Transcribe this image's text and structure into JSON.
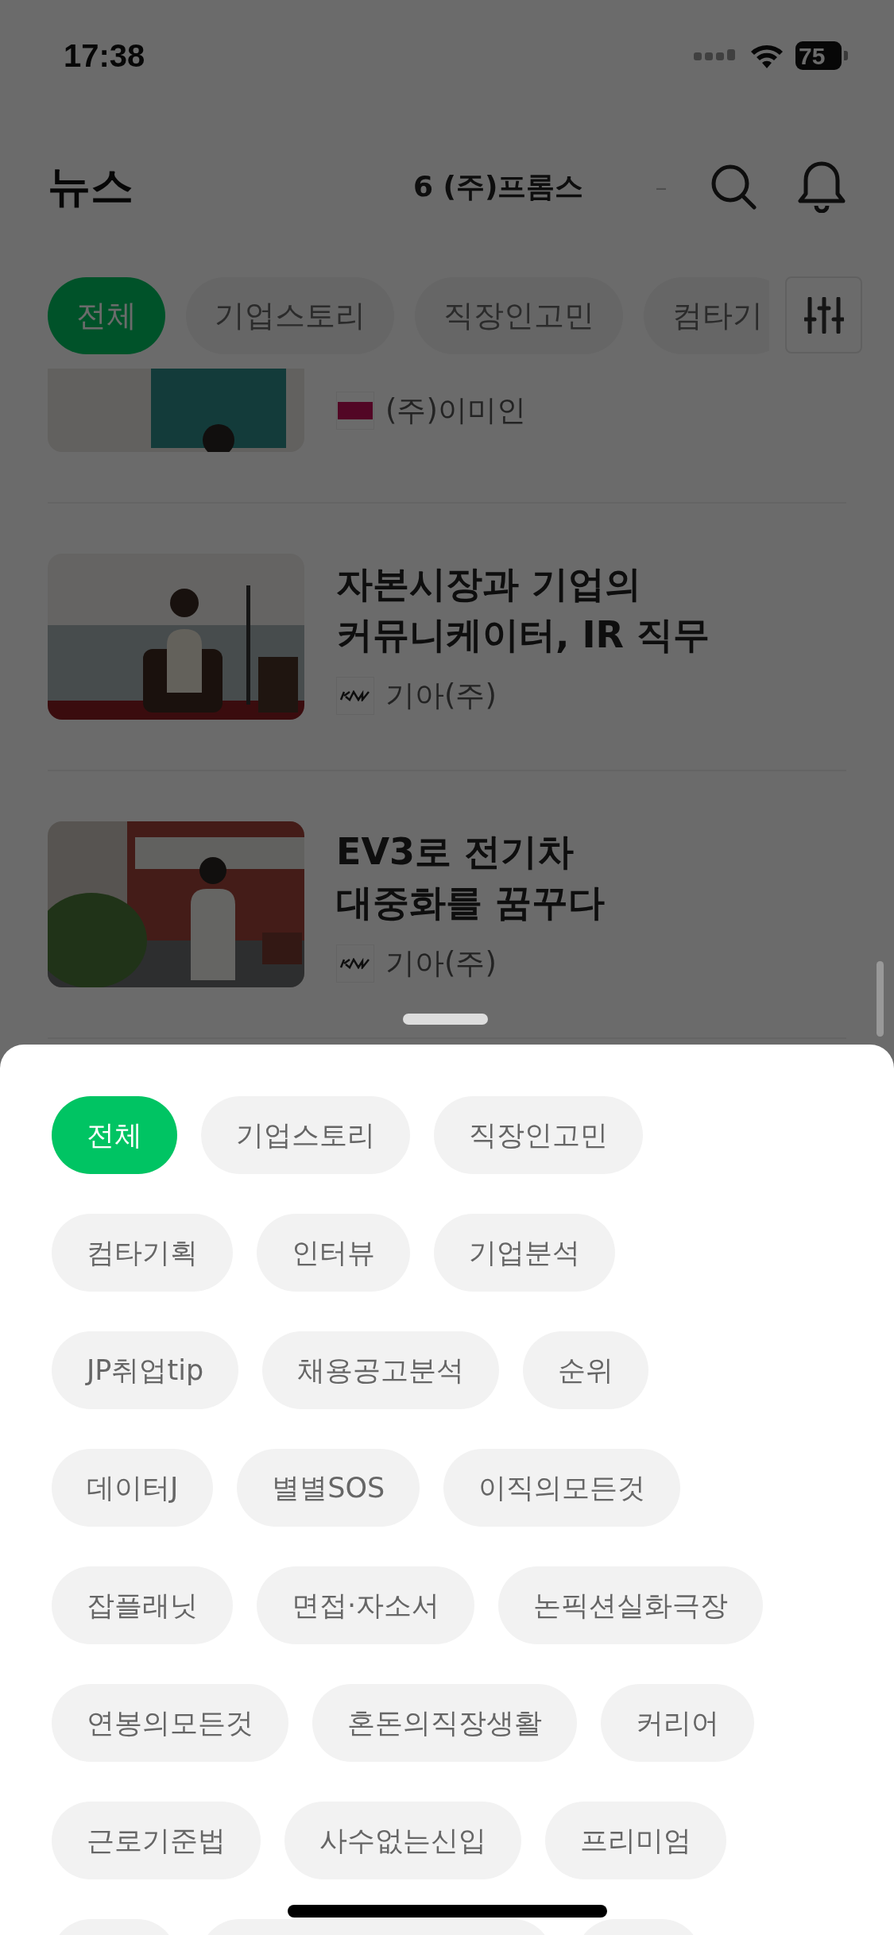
{
  "status_bar": {
    "time": "17:38",
    "battery": "75"
  },
  "header": {
    "title": "뉴스",
    "ticker": "6 (주)프롬스",
    "ticker_mark": "–"
  },
  "tabs": [
    {
      "label": "전체",
      "selected": true
    },
    {
      "label": "기업스토리",
      "selected": false
    },
    {
      "label": "직장인고민",
      "selected": false
    },
    {
      "label": "컴타기",
      "selected": false
    }
  ],
  "articles": [
    {
      "kind": "picture",
      "company": "(주)이미인",
      "logo": {
        "kind": "square"
      }
    },
    {
      "kind": "picture",
      "title": "자본시장과 기업의\n커뮤니케이터, IR 직무",
      "company": "기아(주)",
      "logo": {
        "kind": "wordmark"
      }
    },
    {
      "kind": "picture",
      "title": "EV3로 전기차\n대중화를 꿈꾸다",
      "company": "기아(주)",
      "logo": {
        "kind": "wordmark"
      }
    }
  ],
  "sheet": {
    "chips": [
      {
        "label": "전체",
        "selected": true
      },
      {
        "label": "기업스토리",
        "selected": false
      },
      {
        "label": "직장인고민",
        "selected": false
      },
      {
        "label": "컴타기획",
        "selected": false
      },
      {
        "label": "인터뷰",
        "selected": false
      },
      {
        "label": "기업분석",
        "selected": false
      },
      {
        "label": "JP취업tip",
        "selected": false
      },
      {
        "label": "채용공고분석",
        "selected": false
      },
      {
        "label": "순위",
        "selected": false
      },
      {
        "label": "데이터J",
        "selected": false
      },
      {
        "label": "별별SOS",
        "selected": false
      },
      {
        "label": "이직의모든것",
        "selected": false
      },
      {
        "label": "잡플래닛",
        "selected": false
      },
      {
        "label": "면접·자소서",
        "selected": false
      },
      {
        "label": "논픽션실화극장",
        "selected": false
      },
      {
        "label": "연봉의모든것",
        "selected": false
      },
      {
        "label": "혼돈의직장생활",
        "selected": false
      },
      {
        "label": "커리어",
        "selected": false
      },
      {
        "label": "근로기준법",
        "selected": false
      },
      {
        "label": "사수없는신입",
        "selected": false
      },
      {
        "label": "프리미엄",
        "selected": false
      }
    ]
  }
}
